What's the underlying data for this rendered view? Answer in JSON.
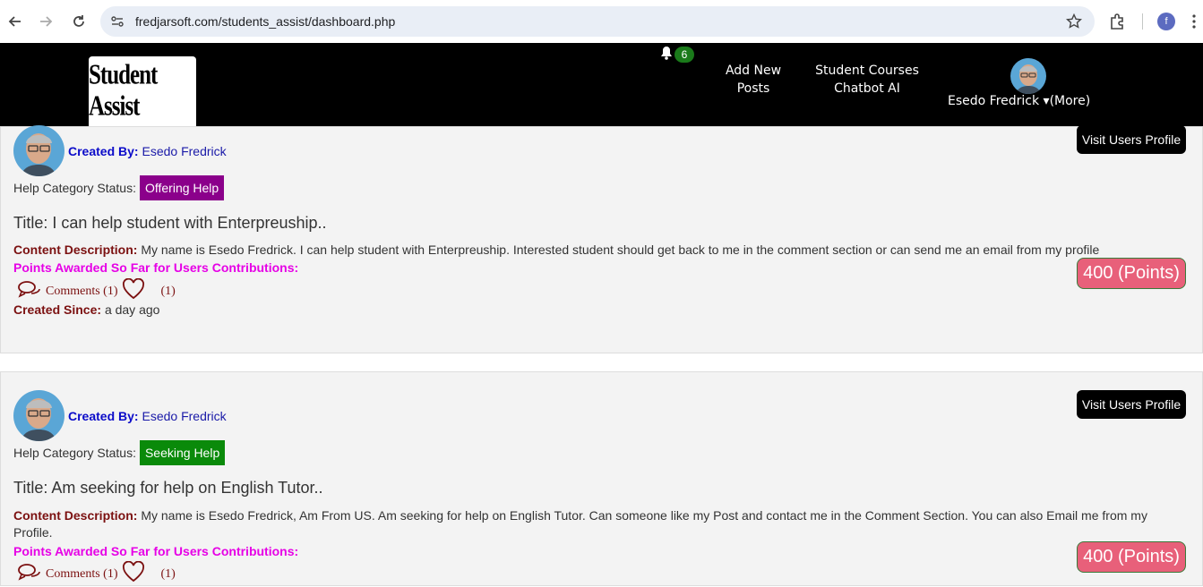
{
  "browser": {
    "url": "fredjarsoft.com/students_assist/dashboard.php",
    "profile_initial": "f"
  },
  "header": {
    "logo_text": "Student Assist",
    "notification_count": "6",
    "add_new_posts": [
      "Add New",
      "Posts"
    ],
    "courses": [
      "Student Courses",
      "Chatbot AI"
    ],
    "user_menu": "Esedo Fredrick ▾(More)"
  },
  "posts": [
    {
      "created_by_label": "Created By:",
      "author": "Esedo Fredrick",
      "visit_label": "Visit Users Profile",
      "status_label": "Help Category Status:",
      "status": "Offering Help",
      "status_color": "#8b008b",
      "title": "Title: I can help student with Enterpreuship..",
      "desc_label": "Content Description:",
      "description": "My name is Esedo Fredrick. I can help student with Enterpreuship. Interested student should get back to me in the comment section or can send me an email from my profile",
      "points_label": "Points Awarded So Far for Users Contributions:",
      "points": "400 (Points)",
      "comments": "Comments (1)",
      "likes": "(1)",
      "since_label": "Created Since:",
      "since": "a day ago"
    },
    {
      "created_by_label": "Created By:",
      "author": "Esedo Fredrick",
      "visit_label": "Visit Users Profile",
      "status_label": "Help Category Status:",
      "status": "Seeking Help",
      "status_color": "#0a8a0a",
      "title": "Title: Am seeking for help on English Tutor..",
      "desc_label": "Content Description:",
      "description": "My name is Esedo Fredrick, Am From US. Am seeking for help on English Tutor. Can someone like my Post and contact me in the Comment Section. You can also Email me from my Profile.",
      "points_label": "Points Awarded So Far for Users Contributions:",
      "points": "400 (Points)",
      "comments": "Comments (1)",
      "likes": "(1)"
    }
  ]
}
